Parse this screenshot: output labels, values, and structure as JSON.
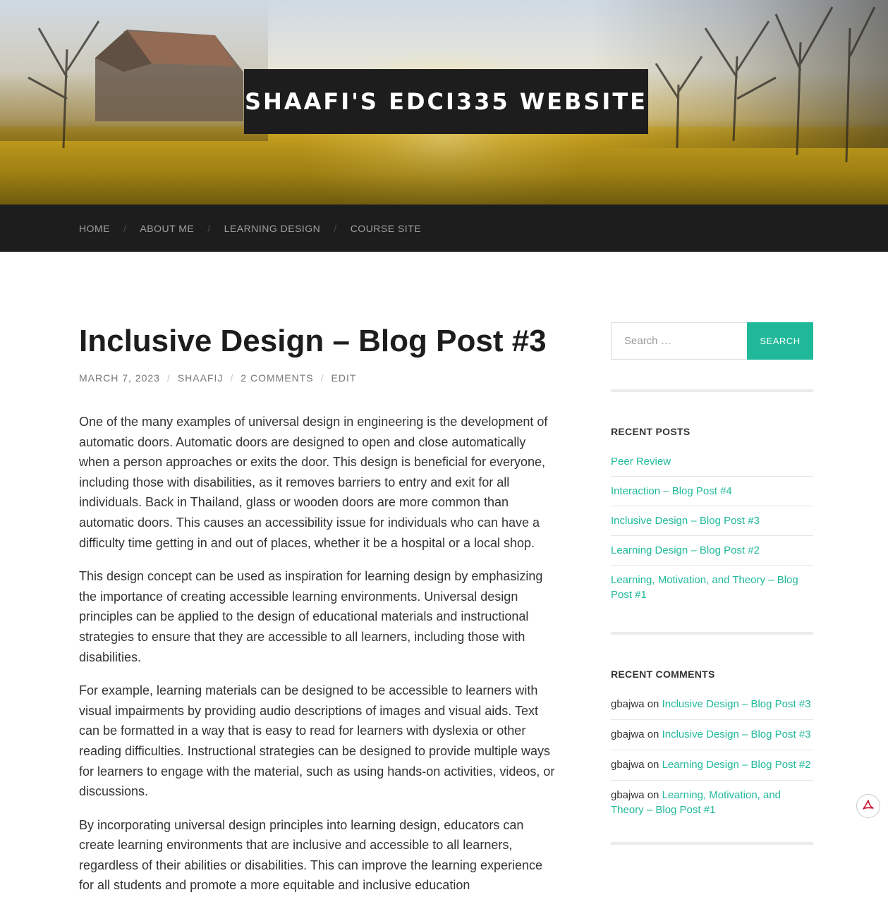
{
  "site": {
    "title": "SHAAFI'S EDCI335 WEBSITE"
  },
  "nav": {
    "items": [
      {
        "label": "HOME"
      },
      {
        "label": "ABOUT ME"
      },
      {
        "label": "LEARNING DESIGN"
      },
      {
        "label": "COURSE SITE"
      }
    ],
    "separator": "/"
  },
  "post": {
    "title": "Inclusive Design – Blog Post #3",
    "meta": {
      "date": "MARCH 7, 2023",
      "author": "SHAAFIJ",
      "comments": "2 COMMENTS",
      "edit": "EDIT"
    },
    "paragraphs": [
      "One of the many examples of universal design in engineering is the development of automatic doors. Automatic doors are designed to open and close automatically when a person approaches or exits the door. This design is beneficial for everyone, including those with disabilities, as it removes barriers to entry and exit for all individuals. Back in Thailand, glass or wooden doors are more common than automatic doors. This causes an accessibility issue for individuals who can have a difficulty time getting in and out of places, whether it be a hospital or a local shop.",
      "This design concept can be used as inspiration for learning design by emphasizing the importance of creating accessible learning environments. Universal design principles can be applied to the design of educational materials and instructional strategies to ensure that they are accessible to all learners, including those with disabilities.",
      "For example, learning materials can be designed to be accessible to learners with visual impairments by providing audio descriptions of images and visual aids. Text can be formatted in a way that is easy to read for learners with dyslexia or other reading difficulties. Instructional strategies can be designed to provide multiple ways for learners to engage with the material, such as using hands-on activities, videos, or discussions.",
      "By incorporating universal design principles into learning design, educators can create learning environments that are inclusive and accessible to all learners, regardless of their abilities or disabilities. This can improve the learning experience for all students and promote a more equitable and inclusive education"
    ]
  },
  "sidebar": {
    "search": {
      "placeholder": "Search …",
      "button_label": "SEARCH"
    },
    "recent_posts": {
      "title": "RECENT POSTS",
      "items": [
        {
          "label": "Peer Review"
        },
        {
          "label": "Interaction – Blog Post #4"
        },
        {
          "label": "Inclusive Design – Blog Post #3"
        },
        {
          "label": "Learning Design – Blog Post #2"
        },
        {
          "label": "Learning, Motivation, and Theory – Blog Post #1"
        }
      ]
    },
    "recent_comments": {
      "title": "RECENT COMMENTS",
      "connector": "on",
      "items": [
        {
          "author": "gbajwa",
          "post": "Inclusive Design – Blog Post #3"
        },
        {
          "author": "gbajwa",
          "post": "Inclusive Design – Blog Post #3"
        },
        {
          "author": "gbajwa",
          "post": "Learning Design – Blog Post #2"
        },
        {
          "author": "gbajwa",
          "post": "Learning, Motivation, and Theory – Blog Post #1"
        }
      ]
    }
  },
  "colors": {
    "accent": "#1fb99a",
    "header_bar": "#1d1d1d",
    "pdf_icon": "#c8102e"
  },
  "icons": {
    "pdf_badge": "pdf-icon"
  }
}
